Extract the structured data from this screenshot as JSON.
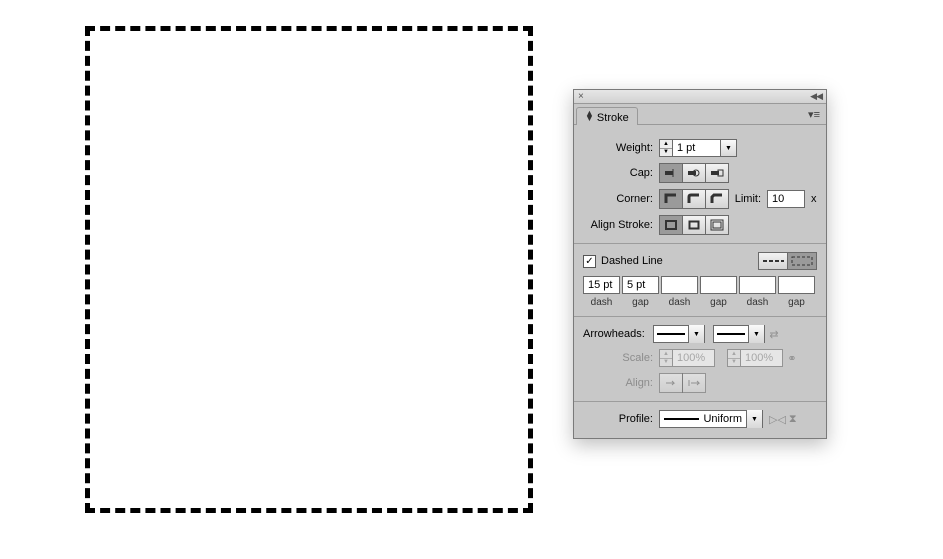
{
  "canvas": {
    "shape": "dashed-rectangle"
  },
  "panel": {
    "title": "Stroke",
    "weight": {
      "label": "Weight:",
      "value": "1 pt"
    },
    "cap": {
      "label": "Cap:",
      "options": [
        "butt",
        "round",
        "projecting"
      ],
      "selected": "butt"
    },
    "corner": {
      "label": "Corner:",
      "options": [
        "miter",
        "round",
        "bevel"
      ],
      "selected": "miter",
      "limit_label": "Limit:",
      "limit_value": "10",
      "limit_suffix": "x"
    },
    "align_stroke": {
      "label": "Align Stroke:",
      "options": [
        "center",
        "inside",
        "outside"
      ],
      "selected": "center"
    },
    "dashed": {
      "checkbox_label": "Dashed Line",
      "checked": true,
      "preserve_selected": "aligned",
      "fields": [
        "15 pt",
        "5 pt",
        "",
        "",
        "",
        ""
      ],
      "field_labels": [
        "dash",
        "gap",
        "dash",
        "gap",
        "dash",
        "gap"
      ]
    },
    "arrowheads": {
      "label": "Arrowheads:",
      "start": "None",
      "end": "None"
    },
    "scale": {
      "label": "Scale:",
      "start": "100%",
      "end": "100%"
    },
    "align": {
      "label": "Align:"
    },
    "profile": {
      "label": "Profile:",
      "value": "Uniform"
    }
  }
}
